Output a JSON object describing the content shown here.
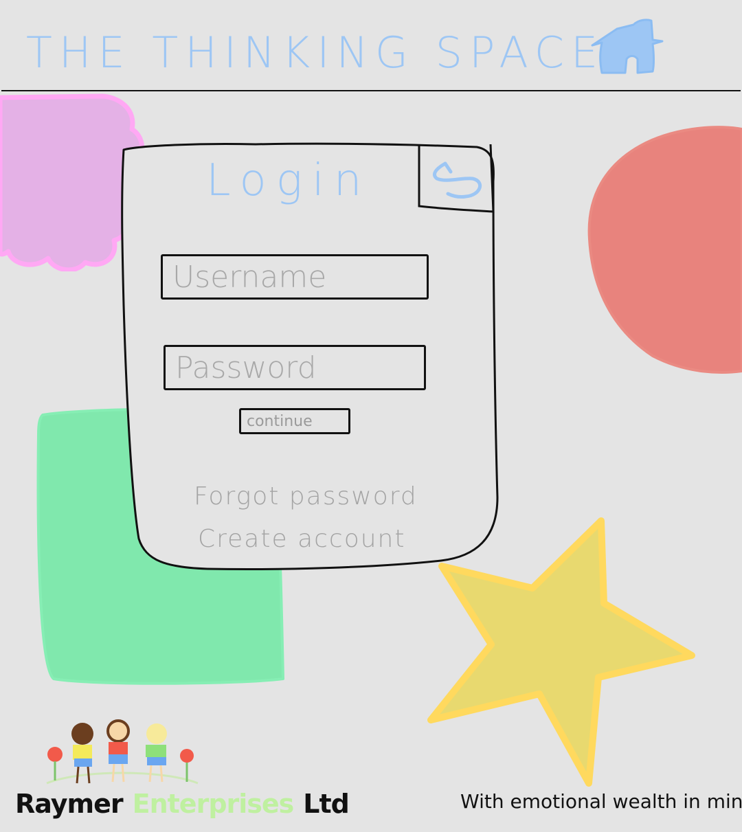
{
  "header": {
    "title": "THE THINKING SPACE",
    "home_icon": "house-icon"
  },
  "colors": {
    "title_blue": "#9dc6f4",
    "blob_pink": "#e4b1e6",
    "blob_pink_outline": "#ffa8f4",
    "blob_red": "#e8837d",
    "blob_green": "#80e8ad",
    "star_fill": "#e8d96f",
    "star_outline": "#ffd95e",
    "background": "#e4e4e4"
  },
  "login": {
    "title": "Login",
    "back_icon": "undo-arrow-icon",
    "username_placeholder": "Username",
    "password_placeholder": "Password",
    "continue_label": "continue",
    "forgot_password": "Forgot password",
    "create_account": "Create account"
  },
  "footer": {
    "company_part_1": "Raymer",
    "company_part_2": "Enterprises",
    "company_part_3": "Ltd",
    "tagline": "With emotional wealth in mind"
  }
}
